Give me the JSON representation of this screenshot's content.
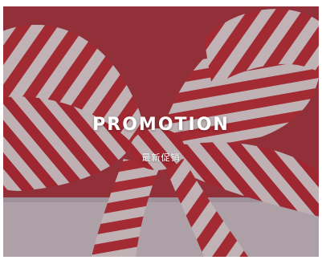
{
  "banner": {
    "title": "PROMOTION",
    "subtitle": "最新促销"
  },
  "image": {
    "subject": "red-white-striped-ribbon-bow-icon",
    "colors": {
      "red": "#c8323c",
      "white": "#f4f0f0",
      "background": "#b8404a",
      "gift_box": "#d9d7dd"
    }
  }
}
